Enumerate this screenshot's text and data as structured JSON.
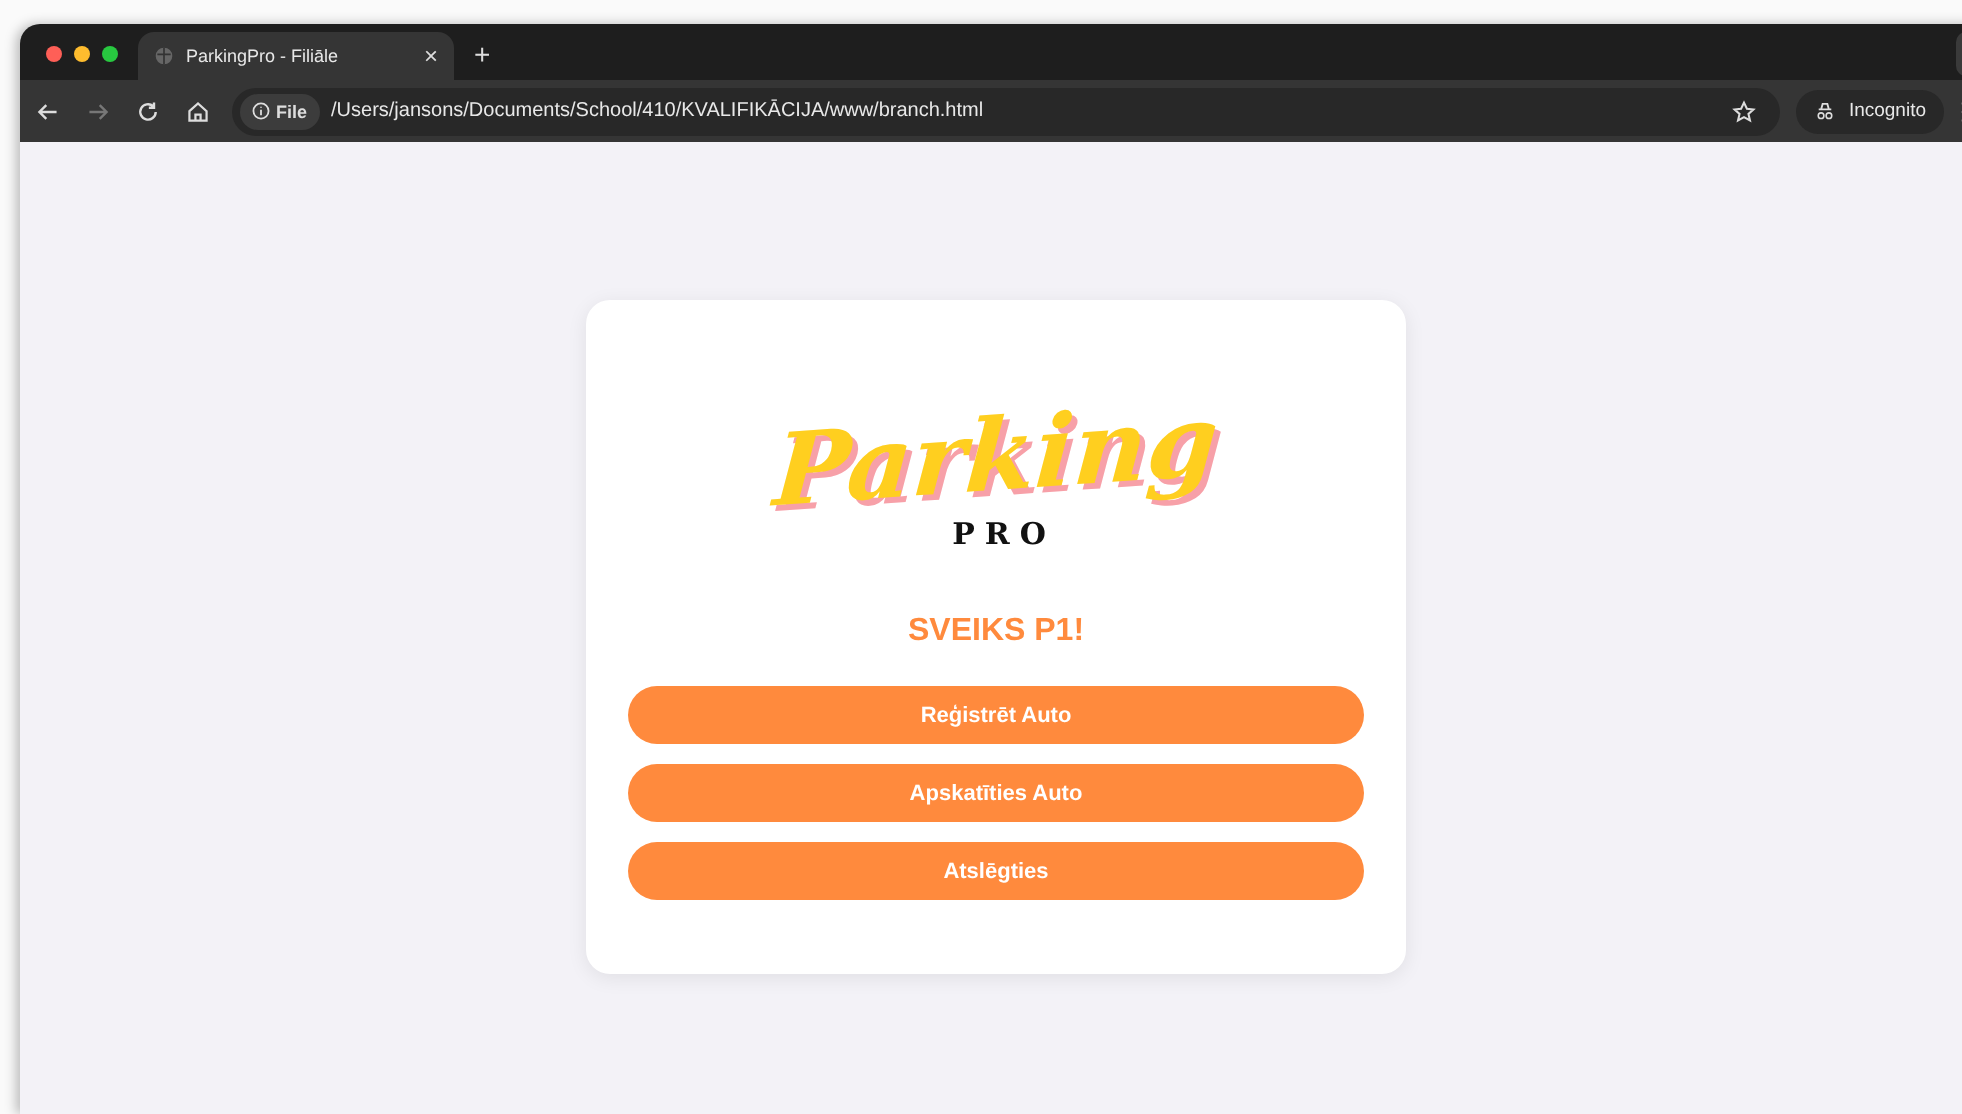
{
  "browser": {
    "tab_title": "ParkingPro - Filiāle",
    "new_tab": "+",
    "close_tab": "×",
    "address_chip": "File",
    "url": "/Users/jansons/Documents/School/410/KVALIFIKĀCIJA/www/branch.html",
    "incognito": "Incognito"
  },
  "card": {
    "logo_script": "Parking",
    "logo_sub": "PRO",
    "greeting": "SVEIKS P1!",
    "buttons": [
      "Reģistrēt Auto",
      "Apskatīties Auto",
      "Atslēgties"
    ]
  }
}
